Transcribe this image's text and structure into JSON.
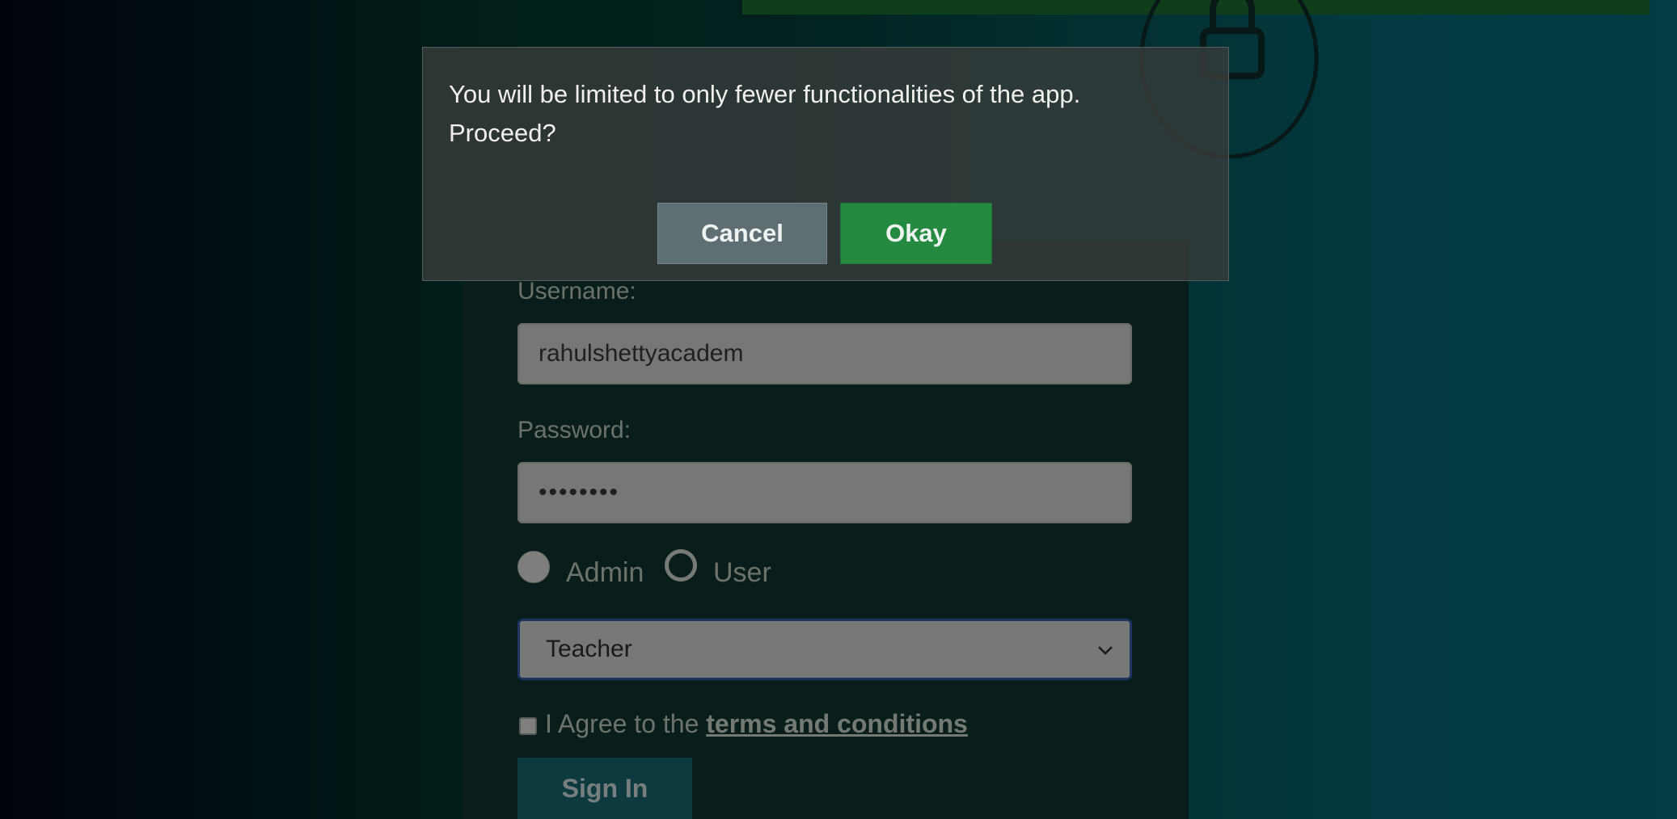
{
  "background_colors": {
    "left": "#010615",
    "middle": "#033f30",
    "right": "#077684"
  },
  "accent_colors": {
    "top_strip": "#1d7a32",
    "okay_button": "#238a3f",
    "cancel_button": "#5f6e73",
    "sign_in_button": "#17707a"
  },
  "decorations": {
    "lock": "lock-icon"
  },
  "login_form": {
    "username_label": "Username:",
    "username_value": "rahulshettyacadem",
    "password_label": "Password:",
    "password_value": "••••••••",
    "radio_options": [
      {
        "label": "Admin",
        "selected": true
      },
      {
        "label": "User",
        "selected": false
      }
    ],
    "role_select": {
      "selected": "Teacher",
      "icon": "chevron-down-icon"
    },
    "agree_prefix": "I Agree to the",
    "agree_link": "terms and conditions",
    "agree_checked": false,
    "sign_in_label": "Sign In"
  },
  "dialog": {
    "message": "You will be limited to only fewer functionalities of the app. Proceed?",
    "cancel_label": "Cancel",
    "okay_label": "Okay"
  }
}
